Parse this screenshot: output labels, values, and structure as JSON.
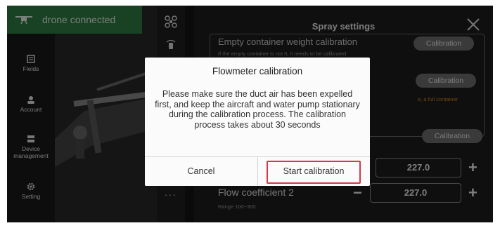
{
  "status": {
    "label": "drone connected",
    "color": "#2f7f44"
  },
  "sidebar": {
    "items": [
      {
        "label": "Fields",
        "icon": "fields-icon"
      },
      {
        "label": "Account",
        "icon": "account-icon"
      },
      {
        "label": "Device management",
        "icon": "device-icon"
      },
      {
        "label": "Setting",
        "icon": "gear-icon"
      }
    ]
  },
  "midbar": {
    "icons": [
      "drone-icon",
      "signal-icon"
    ],
    "more": "..."
  },
  "panel": {
    "title": "Spray settings",
    "empty_weight": {
      "title": "Empty container weight calibration",
      "note": "If the empty container is not 0, it needs to be calibrated",
      "button": "Calibration"
    },
    "full_weight": {
      "button": "Calibration",
      "note": "e, a full container"
    },
    "flowmeter": {
      "button": "Calibration"
    },
    "flow1": {
      "value": "227.0"
    },
    "flow2": {
      "title": "Flow coefficient 2",
      "range": "Range 100~300",
      "value": "227.0"
    }
  },
  "dialog": {
    "title": "Flowmeter calibration",
    "body": "Please make sure the duct air has been expelled first, and keep the aircraft and water pump stationary during the calibration process. The calibration process takes about 30 seconds",
    "cancel": "Cancel",
    "confirm": "Start calibration",
    "highlight_color": "#d9364a"
  }
}
